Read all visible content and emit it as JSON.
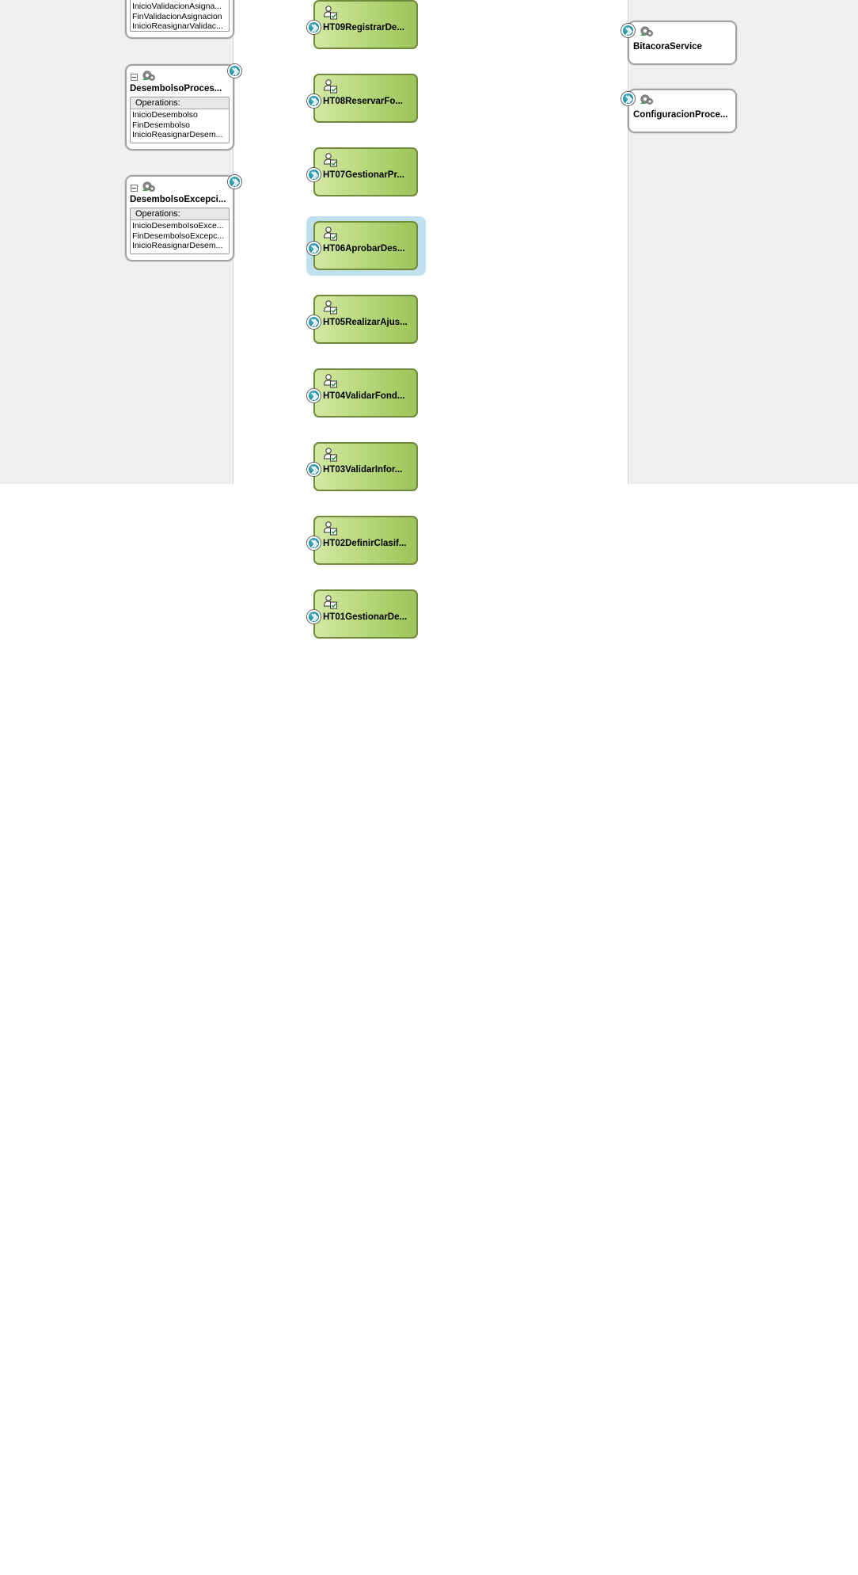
{
  "left_components": [
    {
      "title": "",
      "operations_header": "",
      "operations": [
        "InicioValidacionAsigna...",
        "FinValidacionAsignacion",
        "InicioReasignarValidac..."
      ]
    },
    {
      "title": "DesembolsoProces...",
      "operations_header": "Operations:",
      "operations": [
        "InicioDesembolso",
        "FinDesembolso",
        "InicioReasignarDesem..."
      ]
    },
    {
      "title": "DesembolsoExcepci...",
      "operations_header": "Operations:",
      "operations": [
        "InicioDesemboIsoExce...",
        "FinDesembolsoExcepc...",
        "InicioReasignarDesem..."
      ]
    }
  ],
  "human_tasks": [
    {
      "label": "HT09RegistrarDe...",
      "selected": false
    },
    {
      "label": "HT08ReservarFo...",
      "selected": false
    },
    {
      "label": "HT07GestionarPr...",
      "selected": false
    },
    {
      "label": "HT06AprobarDes...",
      "selected": true
    },
    {
      "label": "HT05RealizarAjus...",
      "selected": false
    },
    {
      "label": "HT04ValidarFond...",
      "selected": false
    },
    {
      "label": "HT03ValidarInfor...",
      "selected": false
    },
    {
      "label": "HT02DefinirClasif...",
      "selected": false
    },
    {
      "label": "HT01GestionarDe...",
      "selected": false
    }
  ],
  "references": [
    {
      "label": "BitacoraService"
    },
    {
      "label": "ConfiguracionProce..."
    }
  ],
  "icons": {
    "service_component": "gear-component-icon",
    "human_task": "human-task-icon",
    "port": "service-arrow-icon",
    "collapse": "collapse-icon"
  },
  "colors": {
    "task_fill": "#b9d97e",
    "task_border": "#6f8a3b",
    "port": "#1c8fa6",
    "selection": "#bfe1ee",
    "lane_bg": "#f0f0f0"
  }
}
